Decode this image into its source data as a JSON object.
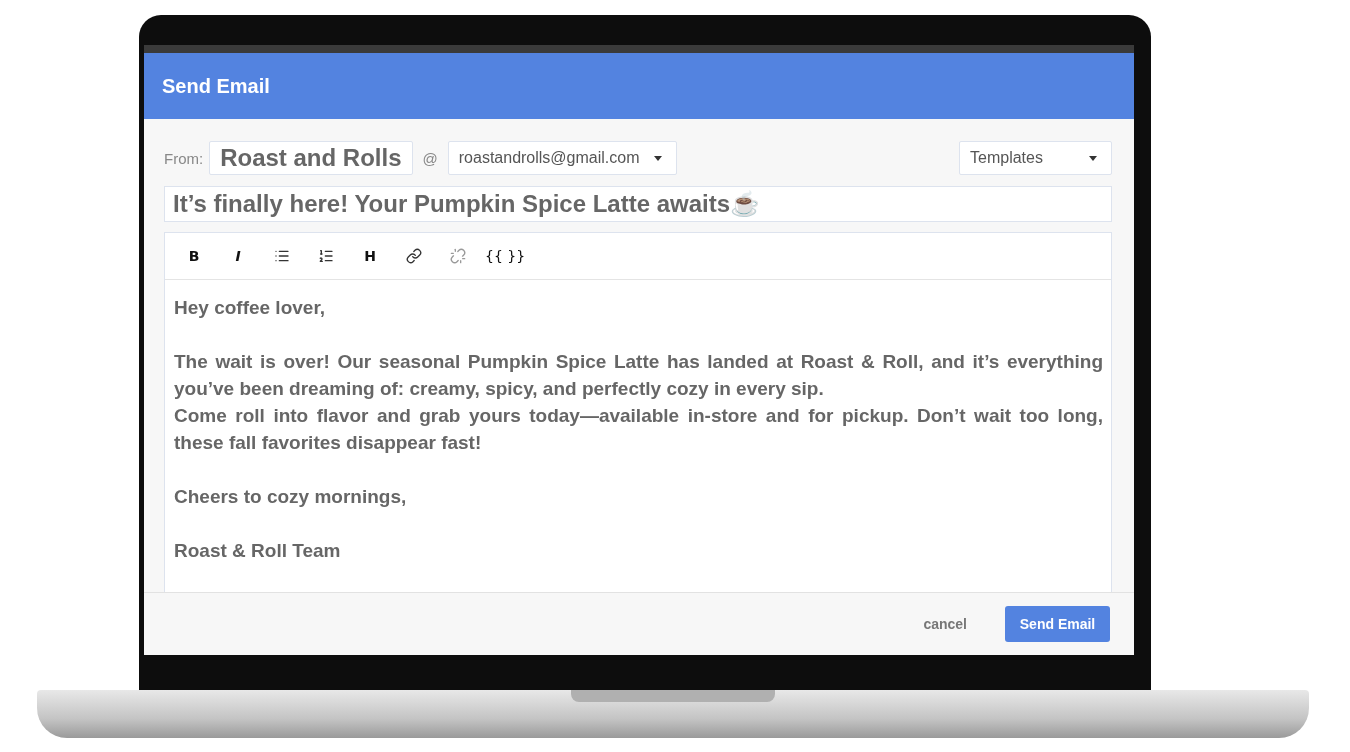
{
  "dialog": {
    "title": "Send Email"
  },
  "from": {
    "label": "From:",
    "name": "Roast and Rolls",
    "at": "@",
    "address": "roastandrolls@gmail.com"
  },
  "templates": {
    "label": "Templates"
  },
  "subject": {
    "value": "It’s finally here! Your Pumpkin Spice Latte awaits☕"
  },
  "toolbar": [
    {
      "kind": "bold",
      "label": "B"
    },
    {
      "kind": "italic",
      "label": "I"
    },
    {
      "kind": "bullets"
    },
    {
      "kind": "numbers"
    },
    {
      "kind": "bold",
      "label": "H"
    },
    {
      "kind": "link"
    },
    {
      "kind": "unlink"
    },
    {
      "kind": "plain",
      "label": "{{ }}"
    }
  ],
  "body": [
    [
      "Hey coffee lover,"
    ],
    [
      "The wait is over! Our seasonal Pumpkin Spice Latte has landed at Roast & Roll, and it’s everything you’ve been dreaming of: creamy, spicy, and perfectly cozy in every sip.",
      "Come roll into flavor and grab yours today—available in-store and for pickup. Don’t wait too long, these fall favorites disappear fast!"
    ],
    [
      "Cheers to cozy mornings,"
    ],
    [
      "Roast & Roll Team"
    ]
  ],
  "buttons": {
    "cancel": "cancel",
    "send": "Send Email"
  }
}
